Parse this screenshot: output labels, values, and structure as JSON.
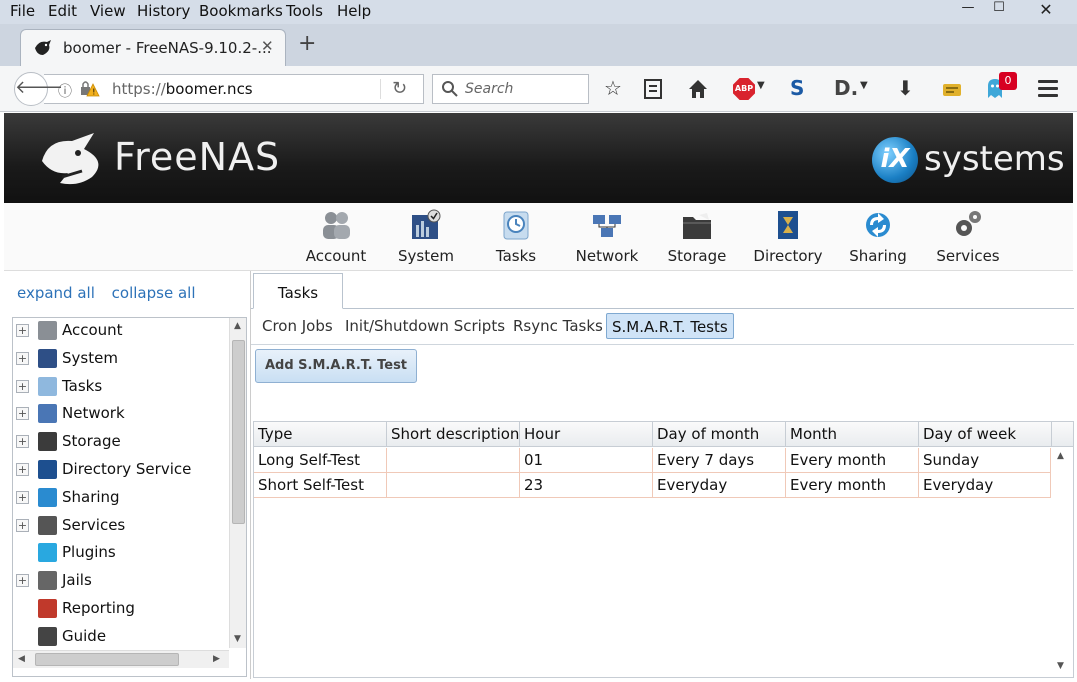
{
  "browser": {
    "menu": [
      "File",
      "Edit",
      "View",
      "History",
      "Bookmarks",
      "Tools",
      "Help"
    ],
    "window_controls": {
      "minimize": "—",
      "maximize": "☐",
      "close": "✕"
    },
    "tab": {
      "title": "boomer - FreeNAS-9.10.2-...",
      "close": "✕"
    },
    "new_tab": "+",
    "url": {
      "scheme": "https://",
      "host": "boomer.ncs"
    },
    "search_placeholder": "Search",
    "abp_label": "ABP",
    "notification_count": "0"
  },
  "header": {
    "logo_text": "FreeNAS",
    "ix_mark": "iX",
    "ix_text": "systems"
  },
  "topnav": {
    "items": [
      {
        "label": "Account",
        "color": "#8a8f95"
      },
      {
        "label": "System",
        "color": "#2e4f86"
      },
      {
        "label": "Tasks",
        "color": "#8fb8de"
      },
      {
        "label": "Network",
        "color": "#4a76b5"
      },
      {
        "label": "Storage",
        "color": "#3b3b3b"
      },
      {
        "label": "Directory",
        "color": "#1d4f8f"
      },
      {
        "label": "Sharing",
        "color": "#2a8bd0"
      },
      {
        "label": "Services",
        "color": "#555555"
      }
    ]
  },
  "tree": {
    "expand_all": "expand all",
    "collapse_all": "collapse all",
    "items": [
      {
        "label": "Account",
        "expandable": true,
        "icon": "account-icon",
        "color": "#8a8f95"
      },
      {
        "label": "System",
        "expandable": true,
        "icon": "system-icon",
        "color": "#2e4f86"
      },
      {
        "label": "Tasks",
        "expandable": true,
        "icon": "tasks-icon",
        "color": "#8fb8de"
      },
      {
        "label": "Network",
        "expandable": true,
        "icon": "network-icon",
        "color": "#4a76b5"
      },
      {
        "label": "Storage",
        "expandable": true,
        "icon": "storage-icon",
        "color": "#3b3b3b"
      },
      {
        "label": "Directory Service",
        "expandable": true,
        "icon": "directory-icon",
        "color": "#1d4f8f"
      },
      {
        "label": "Sharing",
        "expandable": true,
        "icon": "sharing-icon",
        "color": "#2a8bd0"
      },
      {
        "label": "Services",
        "expandable": true,
        "icon": "services-icon",
        "color": "#555555"
      },
      {
        "label": "Plugins",
        "expandable": false,
        "icon": "plugins-icon",
        "color": "#29a8e0"
      },
      {
        "label": "Jails",
        "expandable": true,
        "icon": "jails-icon",
        "color": "#666666"
      },
      {
        "label": "Reporting",
        "expandable": false,
        "icon": "reporting-icon",
        "color": "#c0392b"
      },
      {
        "label": "Guide",
        "expandable": false,
        "icon": "guide-icon",
        "color": "#444444"
      }
    ]
  },
  "main": {
    "tab": "Tasks",
    "subtabs": [
      "Cron Jobs",
      "Init/Shutdown Scripts",
      "Rsync Tasks",
      "S.M.A.R.T. Tests"
    ],
    "active_subtab": "S.M.A.R.T. Tests",
    "add_button": "Add S.M.A.R.T. Test",
    "table": {
      "columns": [
        "Type",
        "Short description",
        "Hour",
        "Day of month",
        "Month",
        "Day of week"
      ],
      "rows": [
        [
          "Long Self-Test",
          "",
          "01",
          "Every 7 days",
          "Every month",
          "Sunday"
        ],
        [
          "Short Self-Test",
          "",
          "23",
          "Everyday",
          "Every month",
          "Everyday"
        ]
      ]
    }
  }
}
